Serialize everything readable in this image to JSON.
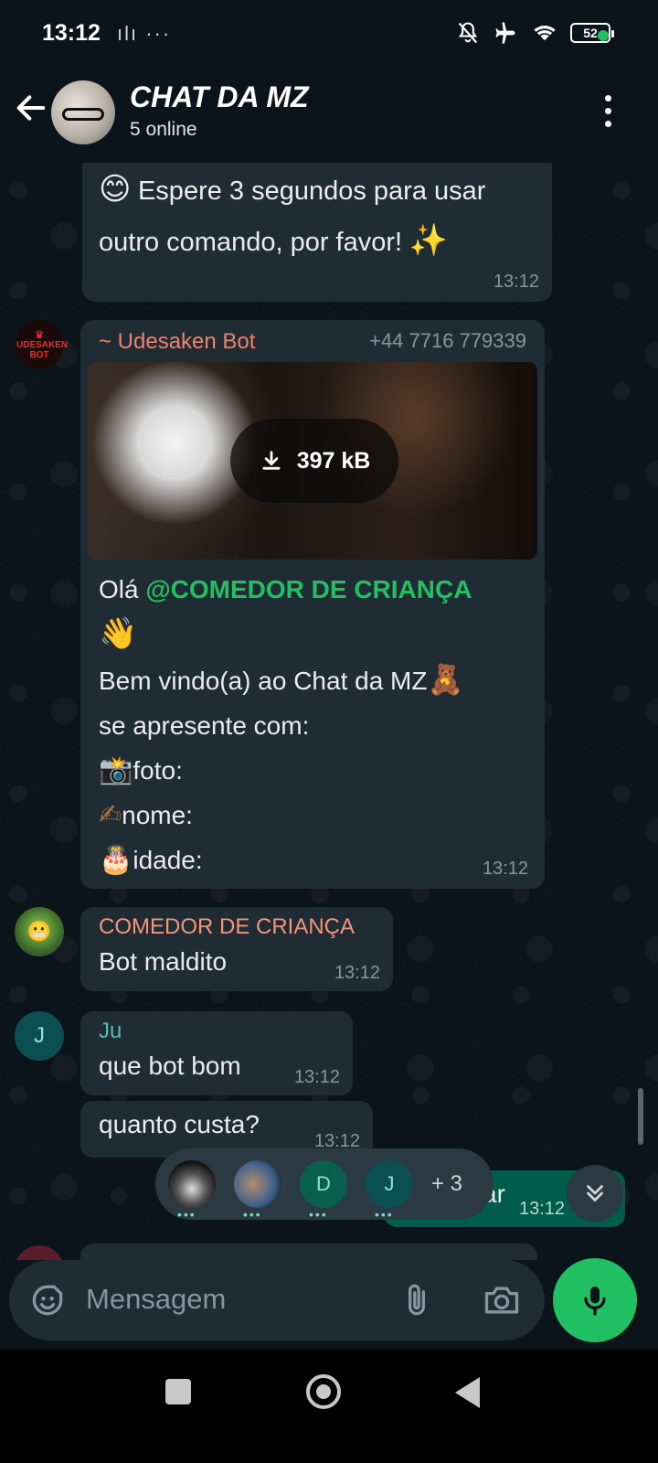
{
  "status_bar": {
    "time": "13:12",
    "left_icons": "ılı ···",
    "battery": "52"
  },
  "header": {
    "title": "CHAT DA MZ",
    "subtitle": "5 online"
  },
  "messages": {
    "bot_notice": {
      "text_line1": "Espere 3 segundos para usar",
      "text_line2": "outro comando, por favor!",
      "emoji_start": "😊",
      "emoji_end": "✨",
      "time": "13:12"
    },
    "welcome": {
      "avatar_text": "UDESAKEN BOT",
      "sender": "~ Udesaken Bot",
      "phone": "+44 7716 779339",
      "media_size": "397 kB",
      "greeting": "Olá ",
      "mention": "@COMEDOR DE CRIANÇA",
      "wave": "👋",
      "line_welcome": "Bem vindo(a) ao Chat da MZ",
      "bear": "🧸",
      "line_present": "se apresente com:",
      "foto_emoji": "📸",
      "foto_label": "foto:",
      "nome_emoji": "✍",
      "nome_label": "nome:",
      "idade_emoji": "🎂",
      "idade_label": "idade:",
      "time": "13:12"
    },
    "comedor": {
      "sender": "COMEDOR DE CRIANÇA",
      "text": "Bot maldito",
      "time": "13:12"
    },
    "ju1": {
      "avatar_letter": "J",
      "sender": "Ju",
      "text": "que bot bom",
      "time": "13:12"
    },
    "ju2": {
      "text": "quanto custa?",
      "time": "13:12"
    },
    "outgoing": {
      "text_partial": "ar",
      "time": "13:12"
    }
  },
  "typing": {
    "users": [
      {
        "letter": "",
        "color": "#1b1b1b"
      },
      {
        "letter": "",
        "color": "#3b5f8a"
      },
      {
        "letter": "D",
        "color": "#0b5f4e"
      },
      {
        "letter": "J",
        "color": "#0b4f53"
      }
    ],
    "more": "+ 3"
  },
  "composer": {
    "placeholder": "Mensagem"
  },
  "colors": {
    "accent_green": "#21c063",
    "bot_sender": "#f0826a",
    "comedor_sender": "#f3957c",
    "ju_sender": "#53bdae",
    "mention": "#21c063"
  }
}
